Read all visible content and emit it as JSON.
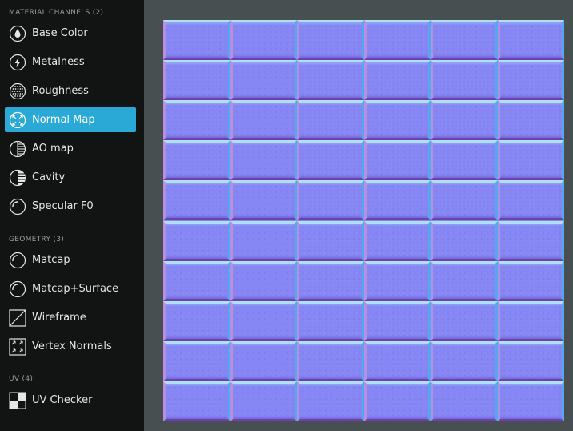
{
  "sidebar": {
    "sections": [
      {
        "title": "MATERIAL CHANNELS (2)",
        "items": [
          {
            "label": "Base Color",
            "icon": "drop-icon",
            "active": false
          },
          {
            "label": "Metalness",
            "icon": "lightning-icon",
            "active": false
          },
          {
            "label": "Roughness",
            "icon": "dots-sphere-icon",
            "active": false
          },
          {
            "label": "Normal Map",
            "icon": "normal-map-icon",
            "active": true
          },
          {
            "label": "AO map",
            "icon": "ao-sphere-icon",
            "active": false
          },
          {
            "label": "Cavity",
            "icon": "cavity-sphere-icon",
            "active": false
          },
          {
            "label": "Specular F0",
            "icon": "specular-sphere-icon",
            "active": false
          }
        ]
      },
      {
        "title": "GEOMETRY (3)",
        "items": [
          {
            "label": "Matcap",
            "icon": "matcap-sphere-icon",
            "active": false
          },
          {
            "label": "Matcap+Surface",
            "icon": "matcap-surface-icon",
            "active": false
          },
          {
            "label": "Wireframe",
            "icon": "wireframe-icon",
            "active": false
          },
          {
            "label": "Vertex Normals",
            "icon": "vertex-normals-icon",
            "active": false
          }
        ]
      },
      {
        "title": "UV (4)",
        "items": [
          {
            "label": "UV Checker",
            "icon": "checker-icon",
            "active": false
          }
        ]
      }
    ]
  },
  "viewport": {
    "texture": {
      "kind": "normal-map brick tiles",
      "rows": 10,
      "columns": 6,
      "base_color": "#8585f5",
      "mortar_highlight": "#aee0f0",
      "mortar_shadow": "#6b42b0"
    }
  },
  "colors": {
    "sidebar_bg": "#121313",
    "viewport_bg": "#484f51",
    "active_accent": "#2aa9d6",
    "section_label": "#9a9a9a"
  }
}
